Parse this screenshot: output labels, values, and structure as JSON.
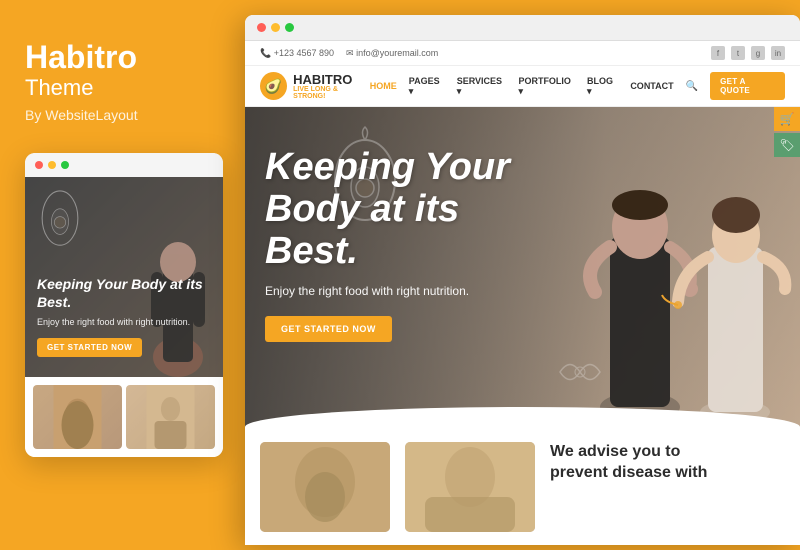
{
  "brand": {
    "name": "Habitro",
    "subtitle": "Theme",
    "by": "By WebsiteLayout"
  },
  "browser": {
    "dots": [
      "red",
      "yellow",
      "green"
    ]
  },
  "topbar": {
    "phone": "+123 4567 890",
    "email": "info@youremail.com",
    "socials": [
      "f",
      "t",
      "g+",
      "in"
    ]
  },
  "nav": {
    "logo_name": "HABITRO",
    "logo_tagline": "LIVE LONG & STRONG!",
    "links": [
      {
        "label": "HOME",
        "active": true,
        "has_arrow": false
      },
      {
        "label": "PAGES",
        "active": false,
        "has_arrow": true
      },
      {
        "label": "SERVICES",
        "active": false,
        "has_arrow": true
      },
      {
        "label": "PORTFOLIO",
        "active": false,
        "has_arrow": true
      },
      {
        "label": "BLOG",
        "active": false,
        "has_arrow": true
      },
      {
        "label": "CONTACT",
        "active": false,
        "has_arrow": false
      }
    ],
    "quote_button": "GET A QUOTE"
  },
  "hero": {
    "title_line1": "Keeping Your",
    "title_line2": "Body at its Best.",
    "subtitle": "Enjoy the right food with right nutrition.",
    "cta_button": "GET STARTED NOW"
  },
  "mobile_hero": {
    "title": "Keeping Your Body at its Best.",
    "subtitle": "Enjoy the right food with right nutrition.",
    "cta_button": "GET STARTED NOW"
  },
  "bottom_section": {
    "heading_line1": "We advise you to",
    "heading_line2": "prevent disease with"
  },
  "icons": {
    "phone": "📞",
    "email": "✉",
    "cart": "🛒",
    "tag": "🏷",
    "search": "🔍",
    "avocado": "🥑"
  }
}
